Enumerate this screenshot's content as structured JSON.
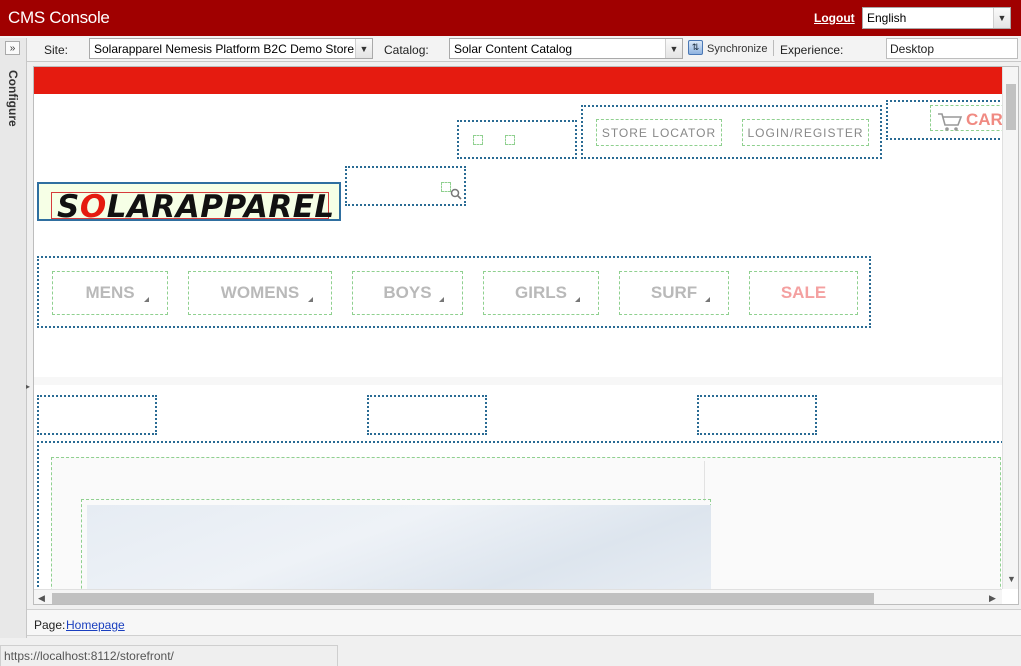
{
  "app": {
    "title": "CMS Console",
    "logout_label": "Logout"
  },
  "language": {
    "selected": "English"
  },
  "toolbar": {
    "site_label": "Site:",
    "site_value": "Solarapparel Nemesis Platform B2C Demo Store",
    "catalog_label": "Catalog:",
    "catalog_value": "Solar Content Catalog",
    "sync_label": "Synchronize",
    "experience_label": "Experience:",
    "experience_value": "Desktop"
  },
  "left_panel": {
    "configure_label": "Configure"
  },
  "storefront": {
    "store_locator": "STORE LOCATOR",
    "login_register": "LOGIN/REGISTER",
    "cart_label": "CART",
    "logo_text_pre": "S",
    "logo_text_o": "O",
    "logo_text_post": "LARAPPAREL",
    "nav": [
      {
        "label": "MENS"
      },
      {
        "label": "WOMENS"
      },
      {
        "label": "BOYS"
      },
      {
        "label": "GIRLS"
      },
      {
        "label": "SURF"
      },
      {
        "label": "SALE"
      }
    ],
    "colors": {
      "banner": "#e51b10",
      "sale": "#f4a0a0",
      "cart": "#f08a82",
      "logo_bg": "#f6ffe6"
    }
  },
  "page_bar": {
    "label": "Page:",
    "page_link": "Homepage"
  },
  "status_bar": {
    "url": "https://localhost:8112/storefront/"
  }
}
